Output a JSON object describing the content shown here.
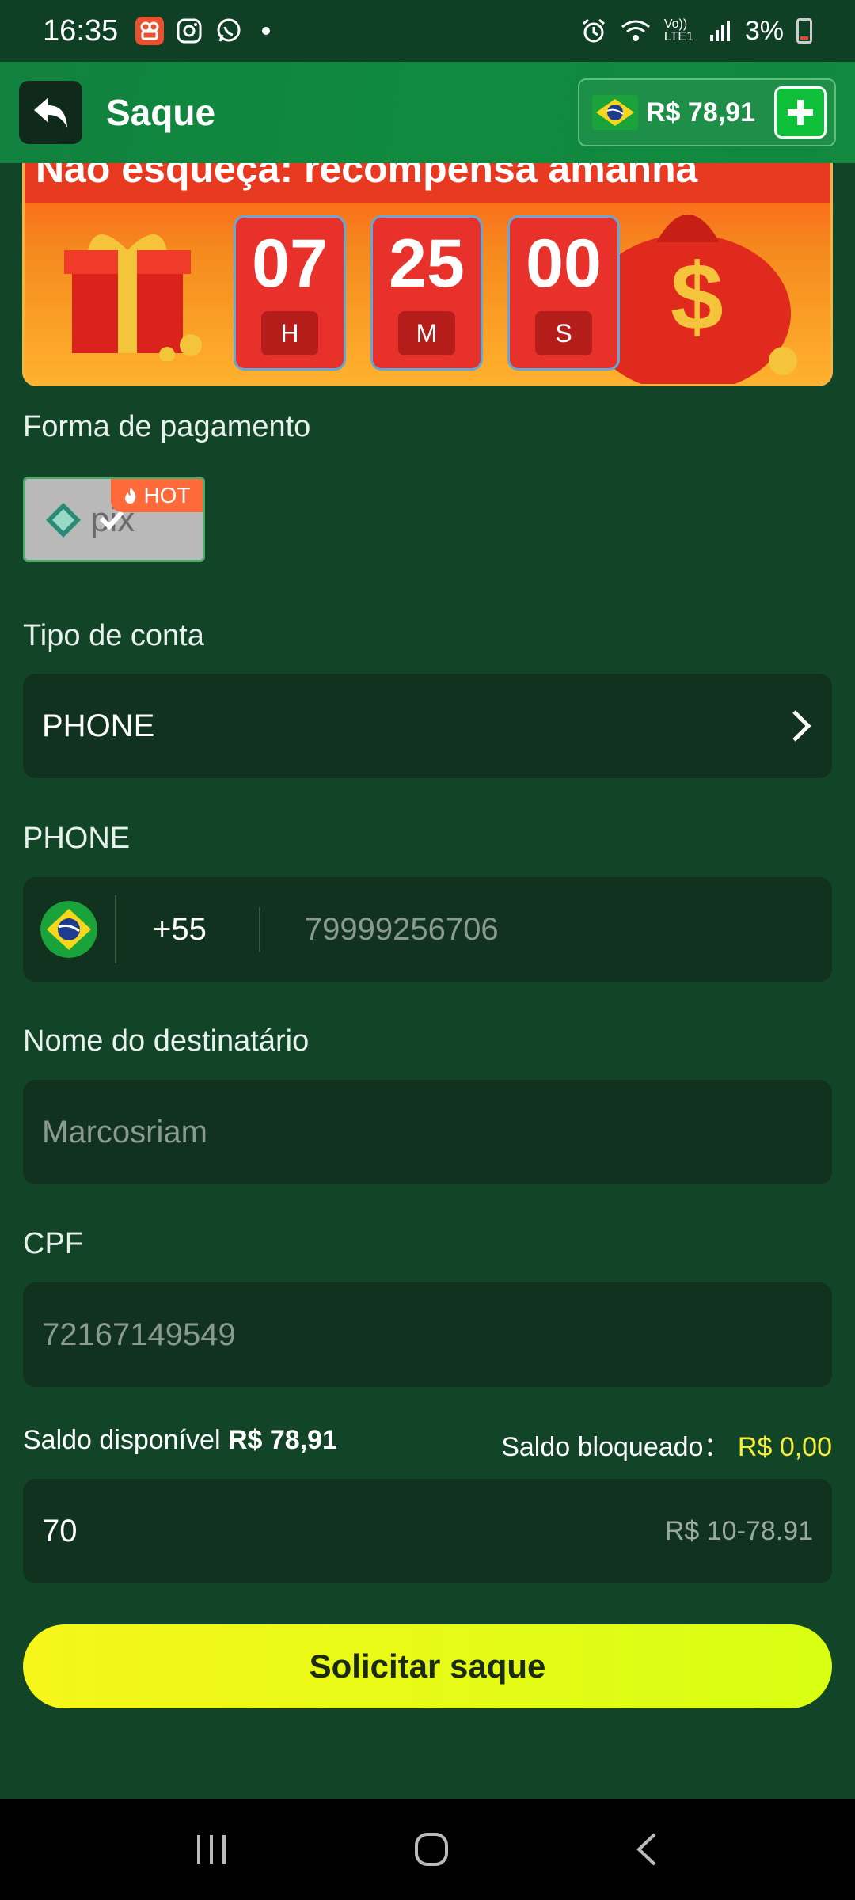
{
  "status_bar": {
    "time": "16:35",
    "battery": "3%",
    "network": "Vo)) LTE1"
  },
  "header": {
    "title": "Saque",
    "balance": "R$ 78,91"
  },
  "banner": {
    "title": "Não esqueça: recompensa amanhã",
    "timer": [
      {
        "value": "07",
        "unit": "H"
      },
      {
        "value": "25",
        "unit": "M"
      },
      {
        "value": "00",
        "unit": "S"
      }
    ]
  },
  "payment": {
    "label": "Forma de pagamento",
    "method_badge": "HOT",
    "method_name": "pix"
  },
  "account_type": {
    "label": "Tipo de conta",
    "value": "PHONE"
  },
  "phone": {
    "label": "PHONE",
    "country_code": "+55",
    "placeholder": "79999256706"
  },
  "recipient": {
    "label": "Nome do destinatário",
    "placeholder": "Marcosriam"
  },
  "cpf": {
    "label": "CPF",
    "placeholder": "72167149549"
  },
  "balance_info": {
    "available_label": "Saldo disponível",
    "available_value": "R$ 78,91",
    "blocked_label": "Saldo bloqueado：",
    "blocked_value": "R$ 0,00"
  },
  "amount": {
    "value": "70",
    "range_hint": "R$ 10-78.91"
  },
  "submit_label": "Solicitar saque",
  "colors": {
    "background": "#124428",
    "header": "#11823f",
    "accent_yellow": "#f5ee3a",
    "button": "#e6fb16"
  }
}
